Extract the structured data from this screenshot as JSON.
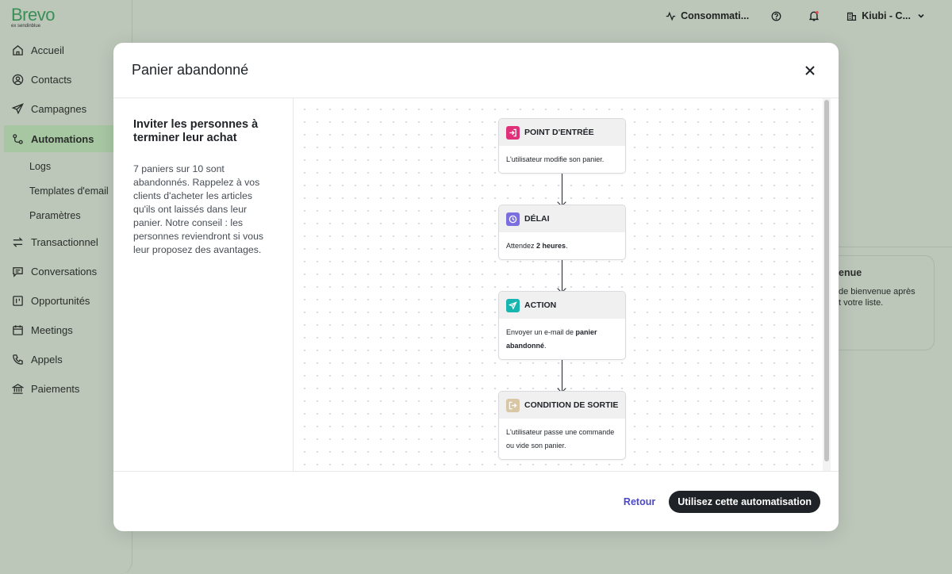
{
  "app": {
    "logo": "Brevo",
    "logo_sub": "ex sendinblue"
  },
  "sidebar": {
    "items": [
      {
        "label": "Accueil",
        "icon": "home-icon"
      },
      {
        "label": "Contacts",
        "icon": "user-circle-icon"
      },
      {
        "label": "Campagnes",
        "icon": "send-icon"
      },
      {
        "label": "Automations",
        "icon": "automation-icon",
        "active": true
      },
      {
        "label": "Logs",
        "sub": true
      },
      {
        "label": "Templates d'email",
        "sub": true
      },
      {
        "label": "Paramètres",
        "sub": true
      },
      {
        "label": "Transactionnel",
        "icon": "transfer-icon"
      },
      {
        "label": "Conversations",
        "icon": "chat-icon"
      },
      {
        "label": "Opportunités",
        "icon": "board-icon"
      },
      {
        "label": "Meetings",
        "icon": "calendar-icon"
      },
      {
        "label": "Appels",
        "icon": "phone-icon"
      },
      {
        "label": "Paiements",
        "icon": "bank-icon"
      }
    ]
  },
  "topbar": {
    "consumption": "Consommati...",
    "account": "Kiubi - C..."
  },
  "background_card": {
    "title": "enue",
    "desc_line1": "de bienvenue après",
    "desc_line2": "t votre liste."
  },
  "modal": {
    "title": "Panier abandonné",
    "left": {
      "title": "Inviter les personnes à terminer leur achat",
      "description": "7 paniers sur 10 sont abandonnés. Rappelez à vos clients d'acheter les articles qu'ils ont laissés dans leur panier. Notre conseil : les personnes reviendront si vous leur proposez des avantages."
    },
    "nodes": [
      {
        "title": "POINT D'ENTRÉE",
        "icon": "entry-icon",
        "color": "#e0307a",
        "text_before": "L'utilisateur modifie son panier.",
        "bold": "",
        "text_after": ""
      },
      {
        "title": "DÉLAI",
        "icon": "clock-icon",
        "color": "#7b6fe0",
        "text_before": "Attendez ",
        "bold": "2 heures",
        "text_after": "."
      },
      {
        "title": "ACTION",
        "icon": "send-icon",
        "color": "#17b5b0",
        "text_before": "Envoyer un e-mail de ",
        "bold": "panier abandonné",
        "text_after": "."
      },
      {
        "title": "CONDITION DE SORTIE",
        "icon": "exit-icon",
        "color": "#d9c6a5",
        "text_before": "L'utilisateur passe une commande ou vide son panier.",
        "bold": "",
        "text_after": ""
      }
    ],
    "footer": {
      "back_label": "Retour",
      "use_label": "Utilisez cette automatisation"
    }
  }
}
